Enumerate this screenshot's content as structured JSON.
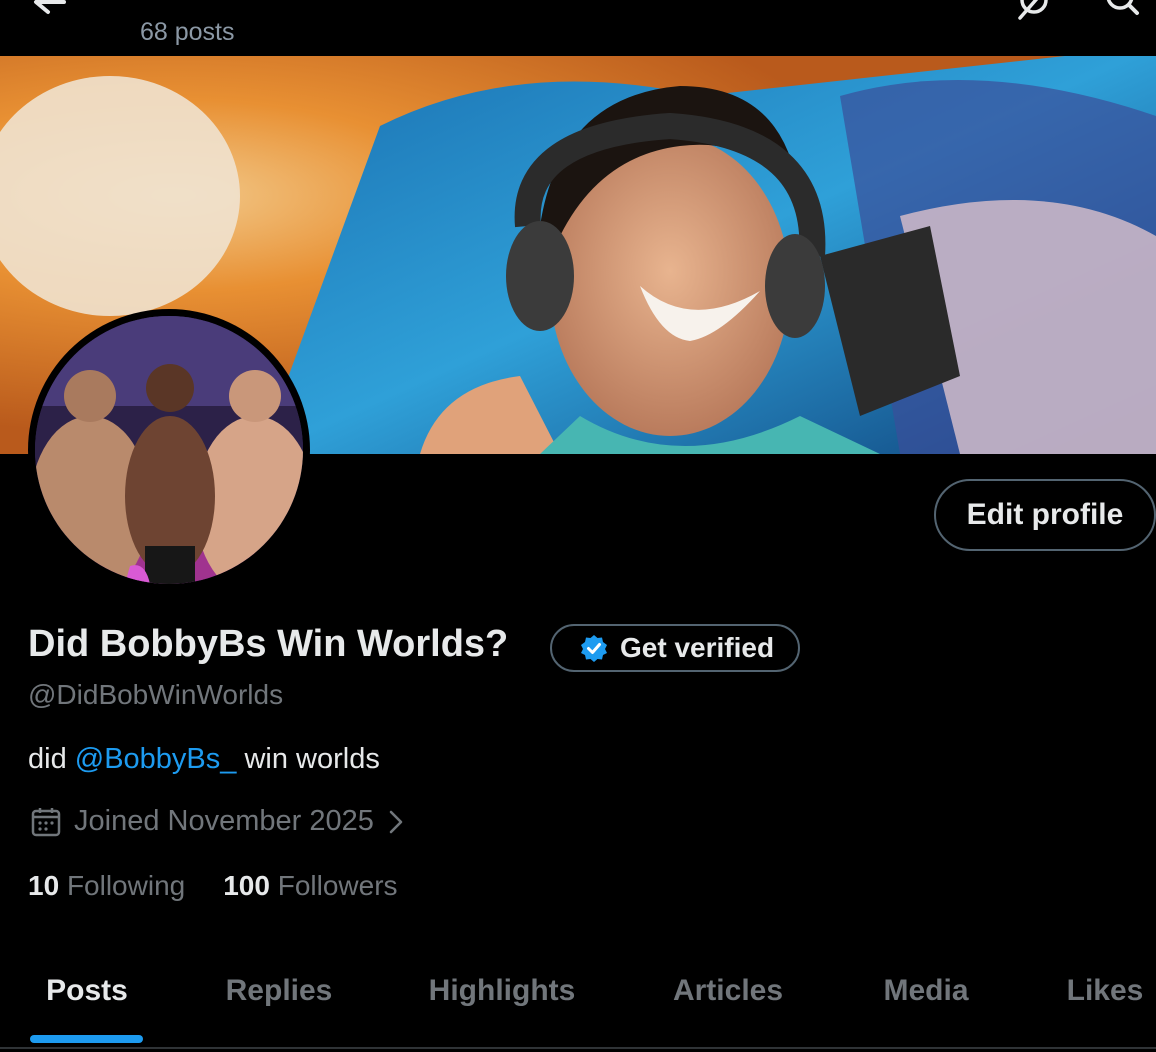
{
  "header": {
    "post_count": "68 posts"
  },
  "profile": {
    "display_name": "Did BobbyBs Win Worlds?",
    "handle": "@DidBobWinWorlds",
    "bio_prefix": "did ",
    "bio_mention": "@BobbyBs_",
    "bio_suffix": " win worlds",
    "joined": "Joined November 2025",
    "edit_profile_label": "Edit profile",
    "get_verified_label": "Get verified",
    "following_count": "10",
    "following_label": "Following",
    "followers_count": "100",
    "followers_label": "Followers"
  },
  "tabs": [
    {
      "label": "Posts",
      "active": true
    },
    {
      "label": "Replies",
      "active": false
    },
    {
      "label": "Highlights",
      "active": false
    },
    {
      "label": "Articles",
      "active": false
    },
    {
      "label": "Media",
      "active": false
    },
    {
      "label": "Likes",
      "active": false
    }
  ],
  "icons": {
    "back": "back-arrow-icon",
    "grok": "grok-icon",
    "search": "search-icon",
    "verified": "verified-badge-icon",
    "calendar": "calendar-icon",
    "chevron": "chevron-right-icon"
  },
  "colors": {
    "accent": "#1d9bf0",
    "background": "#000000",
    "muted_text": "#71767b",
    "primary_text": "#e7e9ea",
    "border": "#536471"
  }
}
